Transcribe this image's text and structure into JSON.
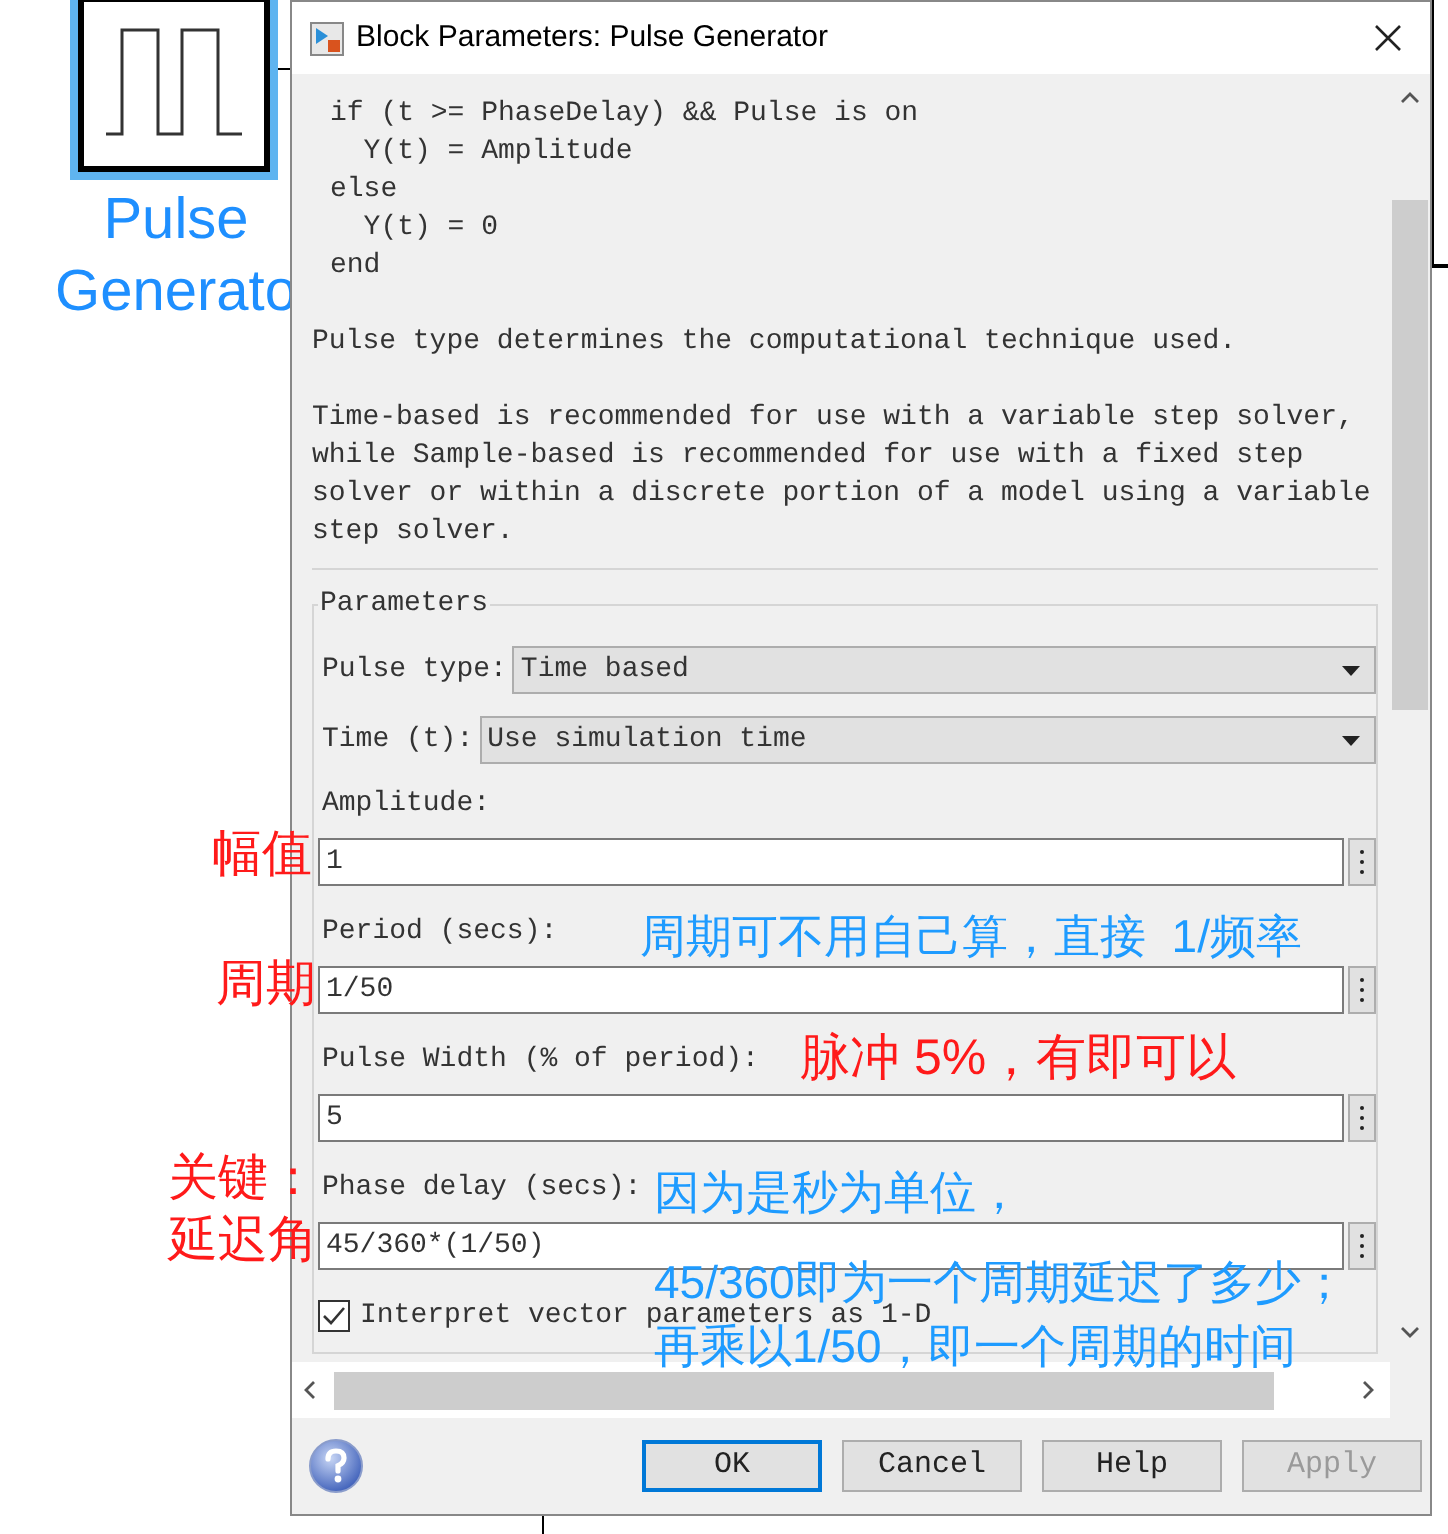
{
  "canvas": {
    "block_label": [
      "Pulse",
      "Generato"
    ]
  },
  "dialog": {
    "title": "Block Parameters: Pulse Generator",
    "code": [
      "if (t >= PhaseDelay) && Pulse is on",
      "  Y(t) = Amplitude",
      "else",
      "  Y(t) = 0",
      "end"
    ],
    "paragraphs": [
      "Pulse type determines the computational technique used.",
      "Time-based is recommended for use with a variable step solver, while Sample-based is recommended for use with a fixed step solver or within a discrete portion of a model using a variable step solver."
    ],
    "group_label": "Parameters",
    "parameters": [
      {
        "kind": "dropdown",
        "label": "Pulse type:",
        "value": "Time based"
      },
      {
        "kind": "dropdown",
        "label": "Time (t):",
        "value": "Use simulation time"
      },
      {
        "kind": "field",
        "label": "Amplitude:",
        "value": "1"
      },
      {
        "kind": "field",
        "label": "Period (secs):",
        "value": "1/50"
      },
      {
        "kind": "field",
        "label": "Pulse Width (% of period):",
        "value": "5"
      },
      {
        "kind": "field",
        "label": "Phase delay (secs):",
        "value": "45/360*(1/50)"
      },
      {
        "kind": "checkbox",
        "label": "Interpret vector parameters as 1-D",
        "checked": true
      }
    ],
    "buttons": [
      {
        "label": "OK",
        "default": true,
        "disabled": false
      },
      {
        "label": "Cancel",
        "default": false,
        "disabled": false
      },
      {
        "label": "Help",
        "default": false,
        "disabled": false
      },
      {
        "label": "Apply",
        "default": false,
        "disabled": true
      }
    ]
  },
  "annotations": [
    {
      "text": "幅值",
      "color": "#ff1a1a"
    },
    {
      "text": "周期",
      "color": "#ff1a1a"
    },
    {
      "text": "周期可不用自己算，直接  1/频率",
      "color": "#1e9bff"
    },
    {
      "text": "脉冲 5%，有即可以",
      "color": "#ff1a1a"
    },
    {
      "text": "关键：",
      "color": "#ff1a1a"
    },
    {
      "text": "延迟角",
      "color": "#ff1a1a"
    },
    {
      "text": "因为是秒为单位，",
      "color": "#1e9bff"
    },
    {
      "text": "45/360即为一个周期延迟了多少；",
      "color": "#1e9bff"
    },
    {
      "text": "再乘以1/50，即一个周期的时间",
      "color": "#1e9bff"
    }
  ]
}
